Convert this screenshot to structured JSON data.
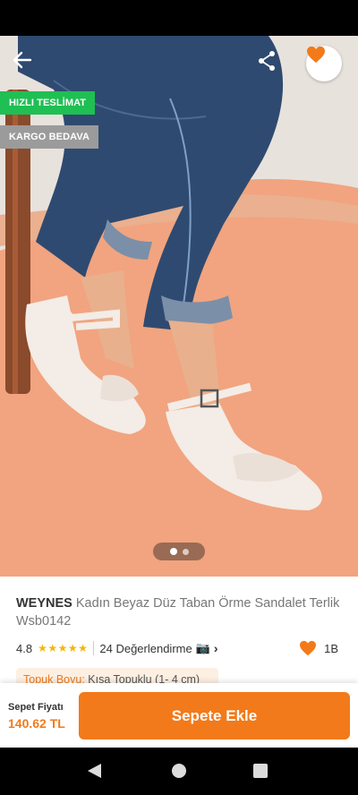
{
  "header": {
    "back_icon": "arrow-left-icon",
    "share_icon": "share-icon",
    "favorite_icon": "heart-icon"
  },
  "badges": {
    "fast_delivery": "HIZLI TESLİMAT",
    "free_cargo": "KARGO BEDAVA"
  },
  "gallery": {
    "current_page": 1,
    "total_pages": 2
  },
  "product": {
    "brand": "WEYNES",
    "name": "Kadın Beyaz Düz Taban Örme Sandalet Terlik Wsb0142",
    "rating": "4.8",
    "stars": "★★★★★",
    "review_count": "24 Değerlendirme",
    "likes": "1B"
  },
  "peek": {
    "label": "Topuk Boyu:",
    "value": "Kısa Topuklu (1- 4 cm)"
  },
  "bottom": {
    "price_label": "Sepet Fiyatı",
    "price": "140.62 TL",
    "add_to_cart": "Sepete Ekle"
  },
  "colors": {
    "accent": "#f27a1a",
    "fast_badge": "#1fbf53",
    "cargo_badge": "#9b9b9b",
    "star": "#f5b60a"
  }
}
